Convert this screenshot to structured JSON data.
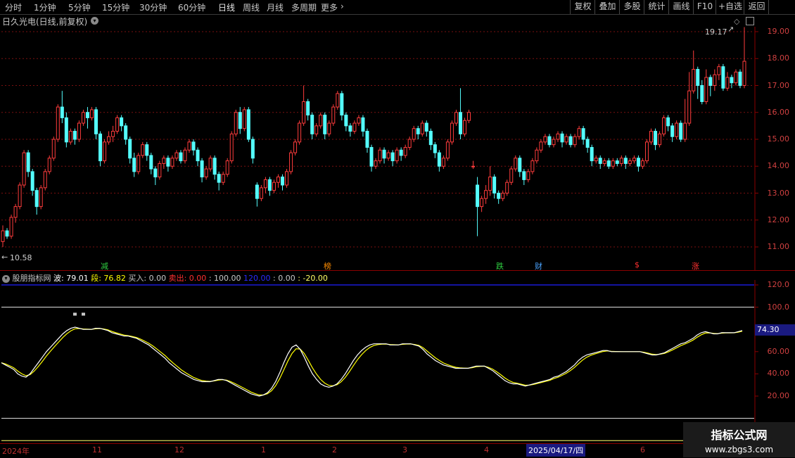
{
  "toolbar": {
    "periods": [
      "分时",
      "1分钟",
      "5分钟",
      "15分钟",
      "30分钟",
      "60分钟",
      "日线",
      "周线",
      "月线",
      "多周期",
      "更多"
    ],
    "active_period": "日线",
    "more_arrow": "›",
    "right_buttons": [
      "复权",
      "叠加",
      "多股",
      "统计",
      "画线",
      "F10",
      "+自选",
      "返回"
    ]
  },
  "main_chart": {
    "title": "日久光电(日线,前复权)",
    "high_label": "19.17",
    "low_label": "10.58",
    "y_axis_ticks": [
      "19.00",
      "18.00",
      "17.00",
      "16.00",
      "15.00",
      "14.00",
      "13.00",
      "12.00",
      "11.00"
    ],
    "signals": [
      {
        "text": "减",
        "color": "#2ecc40"
      },
      {
        "text": "榜",
        "color": "#ff8c00"
      },
      {
        "text": "跌",
        "color": "#2ecc40"
      },
      {
        "text": "财",
        "color": "#4aa3ff"
      },
      {
        "text": "$",
        "color": "#ff3030"
      },
      {
        "text": "涨",
        "color": "#ff3030"
      }
    ]
  },
  "indicator": {
    "name": "股朋指标网",
    "bo_label": "波: 79.01",
    "duan_label": "段: 76.82",
    "buy_label": "买入: 0.00",
    "sell_label": "卖出: 0.00",
    "v100": ": 100.00",
    "v120": "120.00",
    "v0": ": 0.00",
    "vneg": ": -20.00",
    "y_axis_ticks": [
      "120.0",
      "100.0",
      "80.00",
      "60.00",
      "40.00",
      "20.00"
    ],
    "current_value": "74.30",
    "colors": {
      "bo": "#ffffff",
      "duan": "#ffff00"
    }
  },
  "date_axis": {
    "labels": [
      "2024年",
      "11",
      "12",
      "1",
      "2",
      "3",
      "4",
      "2025/04/17/四",
      "6"
    ]
  },
  "watermark": {
    "line1": "指标公式网",
    "line2": "www.zbgs3.com"
  },
  "chart_data": {
    "type": "candlestick",
    "ylim": [
      10.5,
      19.5
    ],
    "candles": [
      [
        11.2,
        11.6,
        11.0,
        11.8
      ],
      [
        11.6,
        11.4,
        11.3,
        11.7
      ],
      [
        11.4,
        12.1,
        11.3,
        12.2
      ],
      [
        12.1,
        12.5,
        11.9,
        12.6
      ],
      [
        12.5,
        13.3,
        12.4,
        13.4
      ],
      [
        13.3,
        14.5,
        13.2,
        14.6
      ],
      [
        14.5,
        13.8,
        13.6,
        14.6
      ],
      [
        13.8,
        13.1,
        12.9,
        13.9
      ],
      [
        13.1,
        12.5,
        12.2,
        13.2
      ],
      [
        12.5,
        13.2,
        12.4,
        13.3
      ],
      [
        13.2,
        13.8,
        13.1,
        13.9
      ],
      [
        13.8,
        14.3,
        13.7,
        14.4
      ],
      [
        14.3,
        15.0,
        14.2,
        15.1
      ],
      [
        15.0,
        16.2,
        14.9,
        16.3
      ],
      [
        16.2,
        15.8,
        15.6,
        16.8
      ],
      [
        15.8,
        14.9,
        14.7,
        16.0
      ],
      [
        14.9,
        15.3,
        14.8,
        15.4
      ],
      [
        15.3,
        15.0,
        14.8,
        15.4
      ],
      [
        15.0,
        15.6,
        14.9,
        15.7
      ],
      [
        15.6,
        16.0,
        15.5,
        16.1
      ],
      [
        16.0,
        15.8,
        15.4,
        16.2
      ],
      [
        15.8,
        16.1,
        15.7,
        16.2
      ],
      [
        16.1,
        15.2,
        15.0,
        16.2
      ],
      [
        15.2,
        14.2,
        14.0,
        15.3
      ],
      [
        14.2,
        14.9,
        14.1,
        15.0
      ],
      [
        14.9,
        15.1,
        14.8,
        15.3
      ],
      [
        15.1,
        15.3,
        14.9,
        15.5
      ],
      [
        15.3,
        15.8,
        15.2,
        15.9
      ],
      [
        15.8,
        15.5,
        15.3,
        15.9
      ],
      [
        15.5,
        15.0,
        14.8,
        15.6
      ],
      [
        15.0,
        14.3,
        14.1,
        15.1
      ],
      [
        14.3,
        13.8,
        13.6,
        14.5
      ],
      [
        13.8,
        14.4,
        13.7,
        14.5
      ],
      [
        14.4,
        14.8,
        14.3,
        14.9
      ],
      [
        14.8,
        14.4,
        14.2,
        14.9
      ],
      [
        14.4,
        13.9,
        13.7,
        14.5
      ],
      [
        13.9,
        13.6,
        13.3,
        14.0
      ],
      [
        13.6,
        14.1,
        13.5,
        14.2
      ],
      [
        14.1,
        14.3,
        13.9,
        14.4
      ],
      [
        14.3,
        14.0,
        13.8,
        14.4
      ],
      [
        14.0,
        14.3,
        13.9,
        14.4
      ],
      [
        14.3,
        14.5,
        14.2,
        14.6
      ],
      [
        14.5,
        14.2,
        14.1,
        14.6
      ],
      [
        14.2,
        14.6,
        14.1,
        14.7
      ],
      [
        14.6,
        14.9,
        14.5,
        15.0
      ],
      [
        14.9,
        14.6,
        14.4,
        15.0
      ],
      [
        14.6,
        14.2,
        14.0,
        14.7
      ],
      [
        14.2,
        13.6,
        13.4,
        14.3
      ],
      [
        13.6,
        13.9,
        13.5,
        14.0
      ],
      [
        13.9,
        14.3,
        13.8,
        14.4
      ],
      [
        14.3,
        13.7,
        13.5,
        14.4
      ],
      [
        13.7,
        13.4,
        13.1,
        13.8
      ],
      [
        13.4,
        13.7,
        13.3,
        13.8
      ],
      [
        13.7,
        14.2,
        13.6,
        14.3
      ],
      [
        14.2,
        15.2,
        14.1,
        15.3
      ],
      [
        15.2,
        16.0,
        15.1,
        16.1
      ],
      [
        16.0,
        15.4,
        15.2,
        16.2
      ],
      [
        15.4,
        16.1,
        15.3,
        16.2
      ],
      [
        16.1,
        15.0,
        14.9,
        16.2
      ],
      [
        15.0,
        14.3,
        14.1,
        15.1
      ],
      [
        13.3,
        12.8,
        12.5,
        13.4
      ],
      [
        12.8,
        13.2,
        12.7,
        13.3
      ],
      [
        13.2,
        13.5,
        13.0,
        13.6
      ],
      [
        13.5,
        13.1,
        12.9,
        13.6
      ],
      [
        13.1,
        13.4,
        13.0,
        13.5
      ],
      [
        13.4,
        13.6,
        13.2,
        13.7
      ],
      [
        13.6,
        13.3,
        13.1,
        13.7
      ],
      [
        13.3,
        13.8,
        13.2,
        13.9
      ],
      [
        13.8,
        14.5,
        13.7,
        14.6
      ],
      [
        14.5,
        14.9,
        14.4,
        15.0
      ],
      [
        14.9,
        15.6,
        14.8,
        15.7
      ],
      [
        15.6,
        16.4,
        15.5,
        17.0
      ],
      [
        16.4,
        15.9,
        15.7,
        16.5
      ],
      [
        15.9,
        15.2,
        15.0,
        16.0
      ],
      [
        15.2,
        15.5,
        15.1,
        15.6
      ],
      [
        15.5,
        15.9,
        15.4,
        16.0
      ],
      [
        15.9,
        15.2,
        15.0,
        16.0
      ],
      [
        15.2,
        15.6,
        15.1,
        15.7
      ],
      [
        15.6,
        16.2,
        15.5,
        16.3
      ],
      [
        16.2,
        16.7,
        16.1,
        16.8
      ],
      [
        16.7,
        15.9,
        15.7,
        16.8
      ],
      [
        15.9,
        15.5,
        15.3,
        16.0
      ],
      [
        15.5,
        15.3,
        15.1,
        15.6
      ],
      [
        15.3,
        15.6,
        15.2,
        15.7
      ],
      [
        15.6,
        15.8,
        15.5,
        15.9
      ],
      [
        15.8,
        15.3,
        15.1,
        15.9
      ],
      [
        15.3,
        14.7,
        14.5,
        15.4
      ],
      [
        14.7,
        14.0,
        13.8,
        14.8
      ],
      [
        14.0,
        14.2,
        13.9,
        14.3
      ],
      [
        14.2,
        14.6,
        14.1,
        14.7
      ],
      [
        14.6,
        14.3,
        14.1,
        14.7
      ],
      [
        14.3,
        14.5,
        14.2,
        14.6
      ],
      [
        14.5,
        14.2,
        14.0,
        14.6
      ],
      [
        14.2,
        14.6,
        14.1,
        14.7
      ],
      [
        14.6,
        14.4,
        14.2,
        14.7
      ],
      [
        14.4,
        14.7,
        14.3,
        14.8
      ],
      [
        14.7,
        15.0,
        14.6,
        15.1
      ],
      [
        15.0,
        15.4,
        14.9,
        15.5
      ],
      [
        15.4,
        15.2,
        15.0,
        15.5
      ],
      [
        15.2,
        15.6,
        15.1,
        15.7
      ],
      [
        15.6,
        15.3,
        15.1,
        15.7
      ],
      [
        15.3,
        14.8,
        14.6,
        15.4
      ],
      [
        14.8,
        14.5,
        14.3,
        14.9
      ],
      [
        14.5,
        14.0,
        13.8,
        14.6
      ],
      [
        14.0,
        14.3,
        13.9,
        14.4
      ],
      [
        14.3,
        14.9,
        14.2,
        15.0
      ],
      [
        14.9,
        15.6,
        14.8,
        15.7
      ],
      [
        15.6,
        16.0,
        15.5,
        16.1
      ],
      [
        16.0,
        15.2,
        15.0,
        16.9
      ],
      [
        15.2,
        15.7,
        15.1,
        15.8
      ],
      [
        15.7,
        16.0,
        15.6,
        16.1
      ],
      [
        14.0,
        14.0,
        13.9,
        14.2
      ],
      [
        13.3,
        12.5,
        11.4,
        13.6
      ],
      [
        12.5,
        12.8,
        12.3,
        12.9
      ],
      [
        12.8,
        13.1,
        12.6,
        13.3
      ],
      [
        13.1,
        13.6,
        12.9,
        14.0
      ],
      [
        13.6,
        13.0,
        12.8,
        13.7
      ],
      [
        13.0,
        12.8,
        12.6,
        13.1
      ],
      [
        12.8,
        13.0,
        12.7,
        13.1
      ],
      [
        13.0,
        13.4,
        12.9,
        13.5
      ],
      [
        13.4,
        13.9,
        13.3,
        14.0
      ],
      [
        13.9,
        14.3,
        13.8,
        14.4
      ],
      [
        14.3,
        13.8,
        13.6,
        14.4
      ],
      [
        13.8,
        13.5,
        13.3,
        13.9
      ],
      [
        13.5,
        13.8,
        13.4,
        13.9
      ],
      [
        13.8,
        14.2,
        13.7,
        14.3
      ],
      [
        14.2,
        14.6,
        14.1,
        14.7
      ],
      [
        14.6,
        14.9,
        14.5,
        15.0
      ],
      [
        14.9,
        15.1,
        14.8,
        15.2
      ],
      [
        15.1,
        14.8,
        14.7,
        15.2
      ],
      [
        14.8,
        15.0,
        14.7,
        15.1
      ],
      [
        15.0,
        15.2,
        14.9,
        15.3
      ],
      [
        15.2,
        14.9,
        14.7,
        15.3
      ],
      [
        14.9,
        15.1,
        14.8,
        15.2
      ],
      [
        15.1,
        14.8,
        14.7,
        15.2
      ],
      [
        14.8,
        15.1,
        14.7,
        15.2
      ],
      [
        15.1,
        15.4,
        15.0,
        15.5
      ],
      [
        15.4,
        15.0,
        14.8,
        15.5
      ],
      [
        15.0,
        14.7,
        14.5,
        15.1
      ],
      [
        14.7,
        14.2,
        14.0,
        14.8
      ],
      [
        14.2,
        14.3,
        14.1,
        14.4
      ],
      [
        14.3,
        14.1,
        13.9,
        14.4
      ],
      [
        14.1,
        14.2,
        14.0,
        14.3
      ],
      [
        14.2,
        14.0,
        13.9,
        14.3
      ],
      [
        14.0,
        14.2,
        13.9,
        14.3
      ],
      [
        14.2,
        14.1,
        14.0,
        14.3
      ],
      [
        14.1,
        14.3,
        14.0,
        14.4
      ],
      [
        14.3,
        14.1,
        13.9,
        14.4
      ],
      [
        14.1,
        14.2,
        14.0,
        14.3
      ],
      [
        14.2,
        14.3,
        14.1,
        14.4
      ],
      [
        14.3,
        14.0,
        13.8,
        14.4
      ],
      [
        14.0,
        14.2,
        13.9,
        14.3
      ],
      [
        14.2,
        14.9,
        14.1,
        15.0
      ],
      [
        14.9,
        15.3,
        14.8,
        15.4
      ],
      [
        15.3,
        14.8,
        14.6,
        15.4
      ],
      [
        14.8,
        15.2,
        14.7,
        15.3
      ],
      [
        15.2,
        15.8,
        15.1,
        15.9
      ],
      [
        15.8,
        15.5,
        15.3,
        15.9
      ],
      [
        15.5,
        15.1,
        14.9,
        15.6
      ],
      [
        15.1,
        15.6,
        15.0,
        15.7
      ],
      [
        15.6,
        15.0,
        14.9,
        15.7
      ],
      [
        15.0,
        15.6,
        14.9,
        16.5
      ],
      [
        15.6,
        16.8,
        15.5,
        17.5
      ],
      [
        16.8,
        17.6,
        16.7,
        18.3
      ],
      [
        17.6,
        17.0,
        16.5,
        17.7
      ],
      [
        17.0,
        16.4,
        16.3,
        17.2
      ],
      [
        16.4,
        17.3,
        16.3,
        17.6
      ],
      [
        17.3,
        17.0,
        16.6,
        17.4
      ],
      [
        17.0,
        17.4,
        16.8,
        17.6
      ],
      [
        17.4,
        17.7,
        17.2,
        17.8
      ],
      [
        17.7,
        16.9,
        16.8,
        17.8
      ],
      [
        16.9,
        17.3,
        16.8,
        17.5
      ],
      [
        17.3,
        17.1,
        16.9,
        17.4
      ],
      [
        17.1,
        17.5,
        17.0,
        17.6
      ],
      [
        17.5,
        17.0,
        16.9,
        17.6
      ],
      [
        17.0,
        17.9,
        16.9,
        19.17
      ]
    ],
    "indicator_bo": [
      50,
      48,
      46,
      44,
      40,
      38,
      37,
      40,
      45,
      50,
      55,
      60,
      64,
      68,
      72,
      76,
      79,
      81,
      82,
      81,
      80,
      80,
      80,
      81,
      81,
      80,
      79,
      77,
      76,
      75,
      74,
      74,
      73,
      72,
      70,
      68,
      66,
      63,
      60,
      57,
      54,
      50,
      47,
      44,
      41,
      39,
      37,
      35,
      34,
      33,
      33,
      33,
      34,
      35,
      35,
      34,
      32,
      30,
      28,
      26,
      24,
      22,
      21,
      20,
      21,
      23,
      27,
      33,
      41,
      50,
      58,
      64,
      66,
      62,
      55,
      47,
      40,
      35,
      31,
      29,
      28,
      29,
      31,
      35,
      40,
      46,
      52,
      57,
      61,
      64,
      66,
      67,
      67,
      67,
      67,
      66,
      66,
      66,
      67,
      67,
      67,
      66,
      65,
      62,
      58,
      55,
      52,
      50,
      48,
      47,
      46,
      45,
      45,
      45,
      45,
      46,
      47,
      47,
      47,
      45,
      43,
      40,
      37,
      34,
      32,
      31,
      31,
      30,
      29,
      30,
      31,
      32,
      33,
      34,
      35,
      37,
      38,
      40,
      42,
      45,
      48,
      52,
      55,
      57,
      58,
      59,
      60,
      61,
      61,
      60,
      60,
      60,
      60,
      60,
      60,
      60,
      60,
      59,
      58,
      57,
      57,
      58,
      59,
      61,
      63,
      65,
      67,
      68,
      70,
      72,
      75,
      77,
      78,
      77,
      76,
      76,
      77,
      77,
      77,
      77,
      78,
      79
    ]
  }
}
